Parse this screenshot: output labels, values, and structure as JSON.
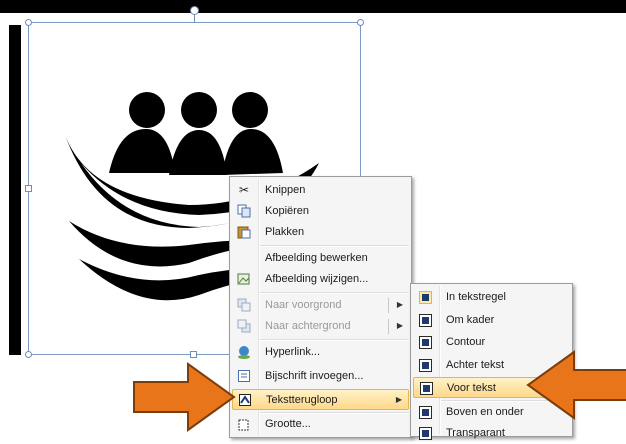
{
  "context_menu": {
    "items": [
      {
        "label": "Knippen",
        "icon": "scissors-icon"
      },
      {
        "label": "Kopiëren",
        "icon": "copy-icon"
      },
      {
        "label": "Plakken",
        "icon": "paste-icon"
      },
      {
        "label": "Afbeelding bewerken",
        "icon": ""
      },
      {
        "label": "Afbeelding wijzigen...",
        "icon": "change-picture-icon"
      },
      {
        "label": "Naar voorgrond",
        "icon": "bring-forward-icon",
        "disabled": true,
        "submenu": true
      },
      {
        "label": "Naar achtergrond",
        "icon": "send-backward-icon",
        "disabled": true,
        "submenu": true
      },
      {
        "label": "Hyperlink...",
        "icon": "hyperlink-icon"
      },
      {
        "label": "Bijschrift invoegen...",
        "icon": "caption-icon"
      },
      {
        "label": "Tekstterugloop",
        "icon": "text-wrap-icon",
        "highlighted": true,
        "submenu": true
      },
      {
        "label": "Grootte...",
        "icon": "size-icon"
      }
    ]
  },
  "wrap_submenu": {
    "items": [
      {
        "label": "In tekstregel"
      },
      {
        "label": "Om kader"
      },
      {
        "label": "Contour"
      },
      {
        "label": "Achter tekst"
      },
      {
        "label": "Voor tekst",
        "highlighted": true
      },
      {
        "label": "Boven en onder"
      },
      {
        "label": "Transparant"
      }
    ]
  },
  "colors": {
    "highlight": "#ffd88a",
    "arrow": "#e8751a",
    "selection_frame": "#7d9ac2"
  }
}
